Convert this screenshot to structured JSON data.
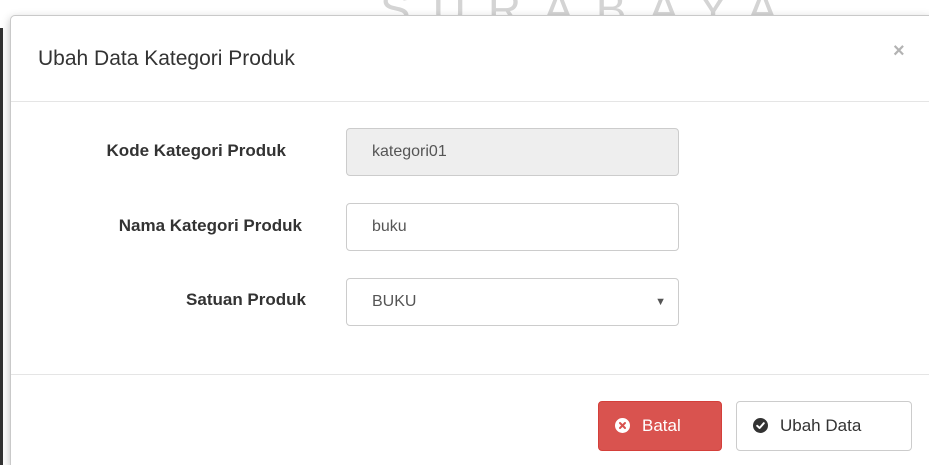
{
  "watermark": "SURABAYA",
  "modal": {
    "title": "Ubah Data Kategori Produk",
    "close_label": "×"
  },
  "form": {
    "fields": [
      {
        "label": "Kode Kategori Produk",
        "value": "kategori01",
        "readonly": true
      },
      {
        "label": "Nama Kategori Produk",
        "value": "buku"
      },
      {
        "label": "Satuan Produk",
        "value": "BUKU",
        "type": "select"
      }
    ]
  },
  "footer": {
    "cancel_label": "Batal",
    "submit_label": "Ubah Data"
  },
  "colors": {
    "danger": "#d9534f",
    "border": "#cccccc",
    "readonly_bg": "#eeeeee"
  },
  "icons": {
    "cancel": "times-circle-icon",
    "submit": "check-circle-icon",
    "select": "caret-down-icon"
  }
}
